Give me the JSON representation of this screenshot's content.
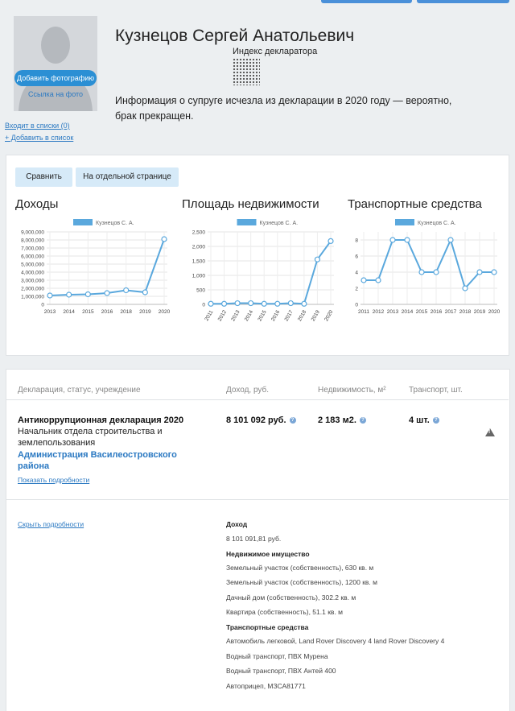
{
  "header": {
    "name": "Кузнецов Сергей Анатольевич",
    "decl_index_label": "Индекс декларатора",
    "add_photo": "Добавить фотографию",
    "photo_link": "Ссылка на фото",
    "info": "Информация о супруге исчезла из декларации в 2020 году — вероятно, брак прекращен.",
    "in_lists": "Входит в списки (0)",
    "add_to_list": "+ Добавить в список"
  },
  "tabs": {
    "compare": "Сравнить",
    "separate_page": "На отдельной странице"
  },
  "charts": {
    "legend_name": "Кузнецов С. А.",
    "income_title": "Доходы",
    "property_title": "Площадь недвижимости",
    "transport_title": "Транспортные средства"
  },
  "chart_data": [
    {
      "type": "line",
      "title": "Доходы",
      "series": [
        {
          "name": "Кузнецов С. А.",
          "values": [
            1100000,
            1200000,
            1250000,
            1400000,
            1750000,
            1500000,
            8101092
          ]
        }
      ],
      "x": [
        "2013",
        "2014",
        "2015",
        "2016",
        "2018",
        "2019",
        "2020"
      ],
      "yticks": [
        "0",
        "1,000,000",
        "2,000,000",
        "3,000,000",
        "4,000,000",
        "5,000,000",
        "6,000,000",
        "7,000,000",
        "8,000,000",
        "9,000,000"
      ],
      "ylim": [
        0,
        9000000
      ],
      "grid": true,
      "legend": "top-center"
    },
    {
      "type": "line",
      "title": "Площадь недвижимости",
      "series": [
        {
          "name": "Кузнецов С. А.",
          "values": [
            20,
            20,
            40,
            40,
            20,
            20,
            40,
            20,
            1550,
            2183
          ]
        }
      ],
      "x": [
        "2011",
        "2012",
        "2013",
        "2014",
        "2015",
        "2016",
        "2017",
        "2018",
        "2019",
        "2020"
      ],
      "yticks": [
        "0",
        "500",
        "1,000",
        "1,500",
        "2,000",
        "2,500"
      ],
      "ylim": [
        0,
        2500
      ],
      "grid": true,
      "legend": "top-center"
    },
    {
      "type": "line",
      "title": "Транспортные средства",
      "series": [
        {
          "name": "Кузнецов С. А.",
          "values": [
            3,
            3,
            8,
            8,
            4,
            4,
            8,
            2,
            4,
            4
          ]
        }
      ],
      "x": [
        "2011",
        "2012",
        "2013",
        "2014",
        "2015",
        "2016",
        "2017",
        "2018",
        "2019",
        "2020"
      ],
      "yticks": [
        "0",
        "2",
        "4",
        "6",
        "8"
      ],
      "ylim": [
        0,
        9
      ],
      "grid": true,
      "legend": "top-center"
    }
  ],
  "table": {
    "col_decl": "Декларация, статус, учреждение",
    "col_income": "Доход, руб.",
    "col_realty": "Недвижимость, м²",
    "col_transport": "Транспорт, шт.",
    "decl_title": "Антикоррупционная декларация 2020",
    "position": "Начальник отдела строительства и землепользования",
    "organization": "Администрация Василеостровского района",
    "show_details": "Показать подробности",
    "income": "8 101 092 руб.",
    "realty": "2 183 м2.",
    "transport": "4 шт.",
    "q": "?",
    "warn": "!"
  },
  "details": {
    "hide": "Скрыть подробности",
    "income_h": "Доход",
    "income_v": "8 101 091,81 руб.",
    "realty_h": "Недвижимое имущество",
    "realty": [
      "Земельный участок (собственность), 630 кв. м",
      "Земельный участок (собственность), 1200 кв. м",
      "Дачный дом (собственность), 302.2 кв. м",
      "Квартира (собственность), 51.1 кв. м"
    ],
    "transport_h": "Транспортные средства",
    "transport": [
      "Автомобиль легковой, Land Rover Discovery 4 land Rover Discovery 4",
      "Водный транспорт, ПВХ Мурена",
      "Водный транспорт, ПВХ Антей 400",
      "Автоприцеп, МЗСА81771"
    ]
  },
  "colors": {
    "accent": "#2b8fd4",
    "line": "#5aa8dd",
    "link": "#2b79c2"
  }
}
